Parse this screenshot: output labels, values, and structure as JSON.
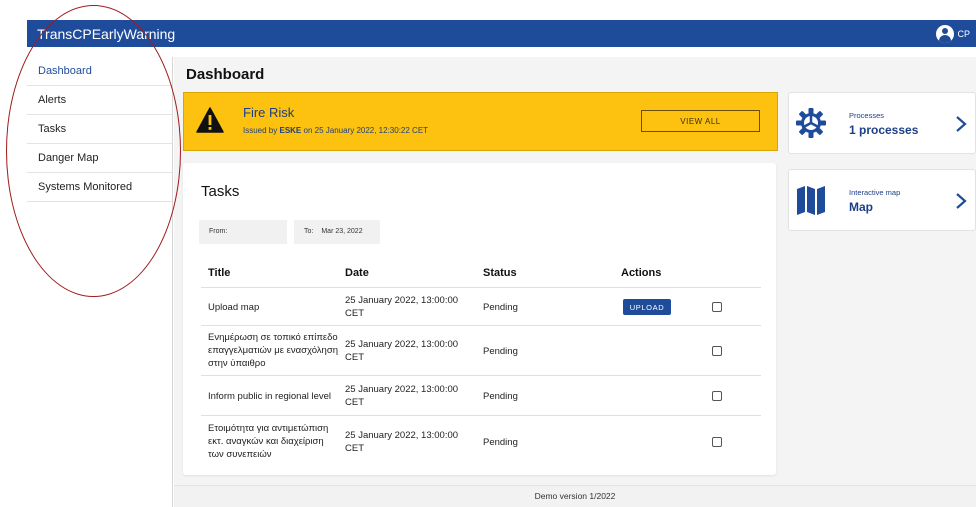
{
  "header": {
    "app_title": "TransCPEarlyWarning",
    "user_initials": "CP",
    "color": "#1f4b9b"
  },
  "sidebar": {
    "items": [
      {
        "label": "Dashboard",
        "active": true
      },
      {
        "label": "Alerts"
      },
      {
        "label": "Tasks"
      },
      {
        "label": "Danger Map"
      },
      {
        "label": "Systems Monitored"
      }
    ]
  },
  "main": {
    "title": "Dashboard"
  },
  "alert": {
    "title": "Fire Risk",
    "issued_prefix": "Issued by",
    "issuer": "ESKE",
    "issued_suffix": "on 25 January 2022, 12:30:22 CET",
    "button": "VIEW ALL",
    "color": "#fcc20f",
    "icon": "warning-triangle-icon"
  },
  "tasks": {
    "title": "Tasks",
    "from_label": "From:",
    "to_label": "To:",
    "to_value": "Mar 23, 2022",
    "columns": [
      "Title",
      "Date",
      "Status",
      "Actions"
    ],
    "rows": [
      {
        "title": "Upload map",
        "date": "25 January 2022, 13:00:00 CET",
        "status": "Pending",
        "action": "UPLOAD"
      },
      {
        "title": "Ενημέρωση σε τοπικό επίπεδο επαγγελματιών με ενασχόληση στην ύπαιθρο",
        "date": "25 January 2022, 13:00:00 CET",
        "status": "Pending"
      },
      {
        "title": "Inform public in regional level",
        "date": "25 January 2022, 13:00:00 CET",
        "status": "Pending"
      },
      {
        "title": "Ετοιμότητα για αντιμετώπιση εκτ. αναγκών και διαχείριση των συνεπειών",
        "date": "25 January 2022, 13:00:00 CET",
        "status": "Pending"
      }
    ]
  },
  "cards": {
    "processes": {
      "label": "Processes",
      "value": "1 processes",
      "icon": "gear-icon"
    },
    "map": {
      "label": "Interactive map",
      "value": "Map",
      "icon": "map-icon"
    }
  },
  "footer": {
    "text": "Demo version 1/2022"
  }
}
